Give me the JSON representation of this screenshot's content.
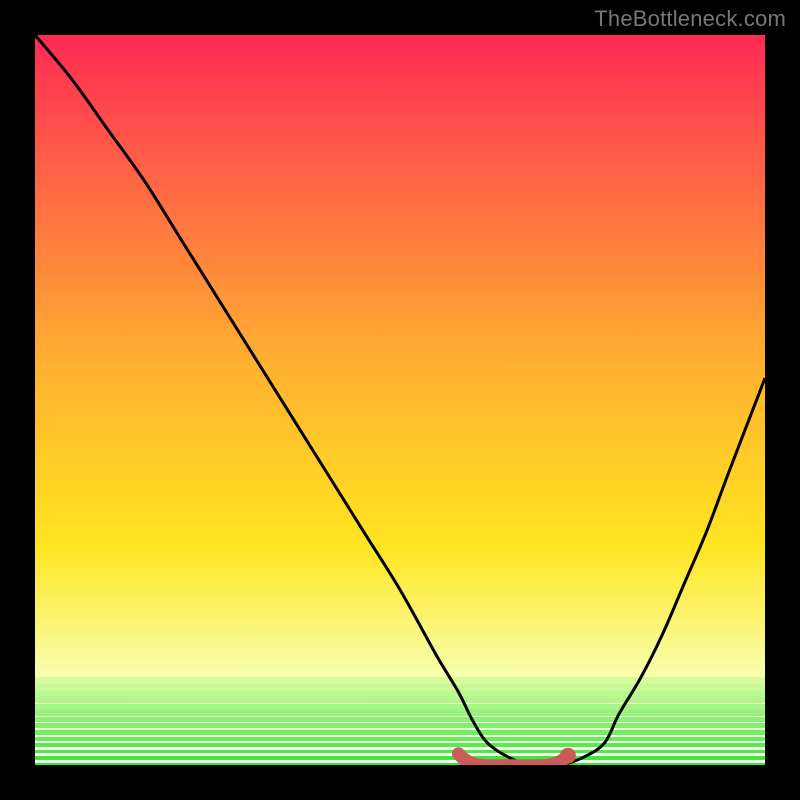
{
  "watermark": "TheBottleneck.com",
  "colors": {
    "frame": "#000000",
    "watermark": "#777777",
    "curve": "#000000",
    "marker": "#cb5a5a",
    "top": "#ff2a55",
    "mid": "#ffe520",
    "bottom_green": "#1de41d",
    "bottom_white": "#f3fff0"
  },
  "chart_data": {
    "type": "line",
    "title": "",
    "xlabel": "",
    "ylabel": "",
    "xlim": [
      0,
      100
    ],
    "ylim": [
      0,
      100
    ],
    "series": [
      {
        "name": "bottleneck-curve",
        "x": [
          0,
          5,
          10,
          15,
          20,
          25,
          30,
          35,
          40,
          45,
          50,
          55,
          58,
          60,
          62,
          65,
          68,
          70,
          72,
          75,
          78,
          80,
          83,
          86,
          89,
          92,
          95,
          100
        ],
        "y": [
          100,
          94,
          87,
          80,
          72,
          64,
          56,
          48,
          40,
          32,
          24,
          15,
          10,
          6,
          3,
          1,
          0,
          0,
          0,
          1,
          3,
          7,
          12,
          18,
          25,
          32,
          40,
          53
        ]
      }
    ],
    "marker_band": {
      "x_start": 58,
      "x_end": 73,
      "y": 1
    },
    "gradient_stops": [
      {
        "pct": 0,
        "color": "#ff2a55"
      },
      {
        "pct": 45,
        "color": "#ffb030"
      },
      {
        "pct": 70,
        "color": "#ffe520"
      },
      {
        "pct": 88,
        "color": "#f8ffb0"
      },
      {
        "pct": 100,
        "color": "#f3fff0"
      }
    ],
    "green_bands_top_pct": 88
  }
}
